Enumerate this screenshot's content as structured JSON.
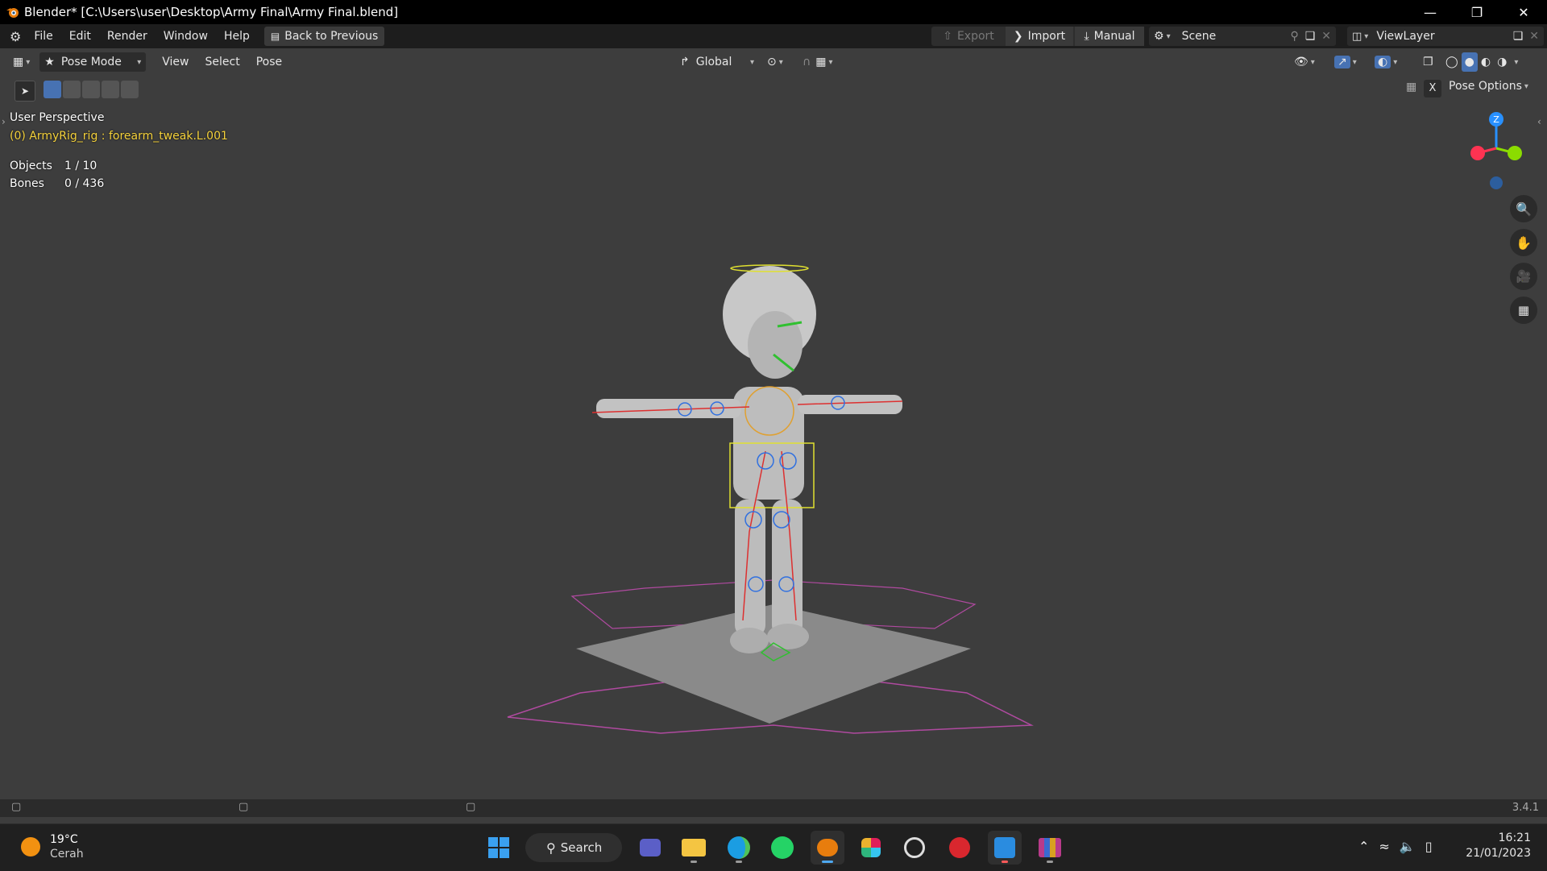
{
  "window": {
    "title": "Blender* [C:\\Users\\user\\Desktop\\Army Final\\Army Final.blend]"
  },
  "menu": {
    "items": [
      "File",
      "Edit",
      "Render",
      "Window",
      "Help"
    ],
    "back_label": "Back to Previous",
    "export_label": "Export",
    "import_label": "Import",
    "manual_label": "Manual",
    "scene_name": "Scene",
    "viewlayer_name": "ViewLayer"
  },
  "viewport_header": {
    "mode": "Pose Mode",
    "menus": [
      "View",
      "Select",
      "Pose"
    ],
    "orientation": "Global",
    "pose_options": "Pose Options",
    "close_x": "X"
  },
  "overlay": {
    "perspective": "User Perspective",
    "active_bone": "(0) ArmyRig_rig : forearm_tweak.L.001",
    "objects_label": "Objects",
    "objects_value": "1 / 10",
    "bones_label": "Bones",
    "bones_value": "0 / 436"
  },
  "gizmo": {
    "z_label": "Z"
  },
  "status": {
    "version": "3.4.1"
  },
  "taskbar": {
    "weather_temp": "19°C",
    "weather_desc": "Cerah",
    "search_label": "Search",
    "time": "16:21",
    "date": "21/01/2023"
  },
  "colors": {
    "viewport_bg": "#3d3d3d",
    "header_bg": "#1d1d1d",
    "active_text": "#f5d23c",
    "axis_x": "#ff3352",
    "axis_y": "#8bdc00",
    "axis_z": "#2890ff"
  }
}
